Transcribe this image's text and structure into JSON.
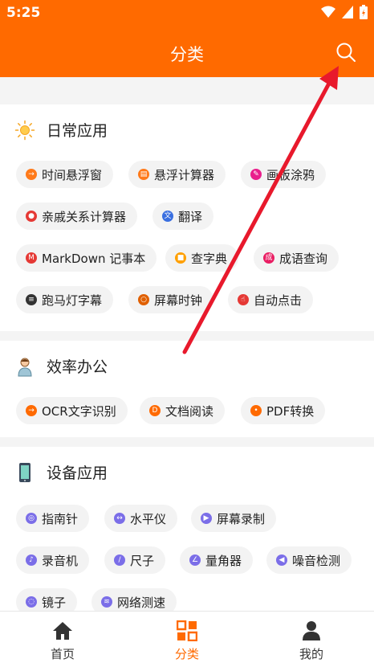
{
  "status": {
    "time": "5:25"
  },
  "header": {
    "title": "分类"
  },
  "sections": {
    "daily": {
      "title": "日常应用",
      "items": [
        "时间悬浮窗",
        "悬浮计算器",
        "画板涂鸦",
        "亲戚关系计算器",
        "翻译",
        "MarkDown 记事本",
        "查字典",
        "成语查询",
        "跑马灯字幕",
        "屏幕时钟",
        "自动点击"
      ]
    },
    "office": {
      "title": "效率办公",
      "items": [
        "OCR文字识别",
        "文档阅读",
        "PDF转换"
      ]
    },
    "device": {
      "title": "设备应用",
      "items": [
        "指南针",
        "水平仪",
        "屏幕录制",
        "录音机",
        "尺子",
        "量角器",
        "噪音检测",
        "镜子",
        "网络测速"
      ]
    }
  },
  "tabs": [
    {
      "label": "首页"
    },
    {
      "label": "分类"
    },
    {
      "label": "我的"
    }
  ],
  "colors": {
    "accent": "#ff6a00",
    "red_arrow": "#e8192c"
  }
}
